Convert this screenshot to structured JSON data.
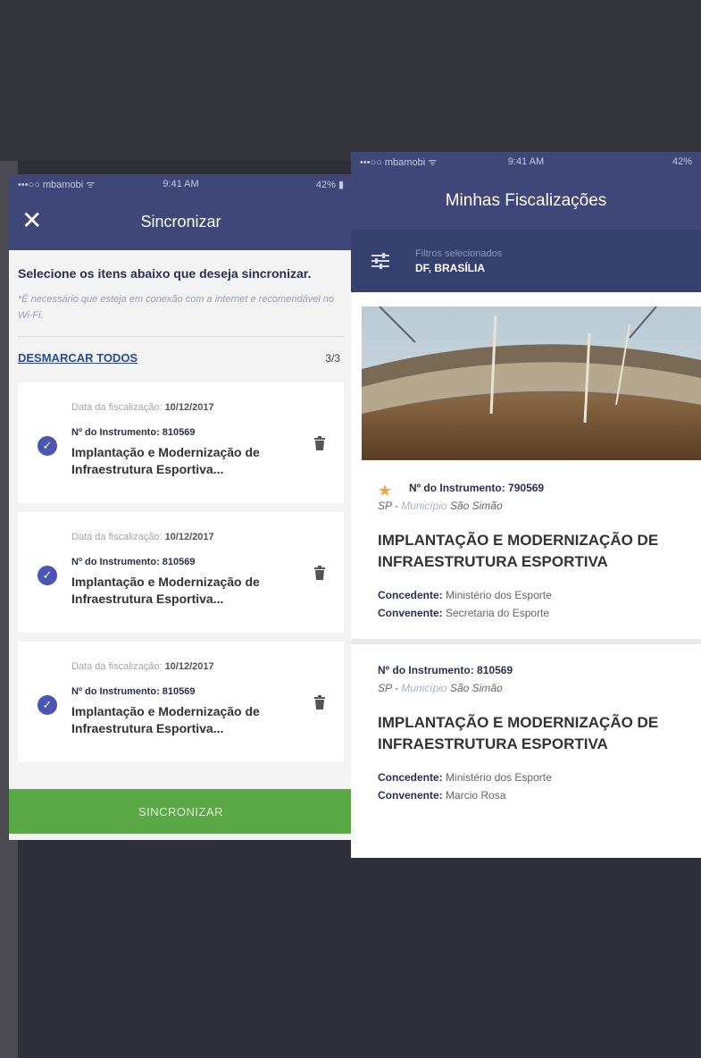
{
  "left_phone": {
    "status": {
      "carrier": "•••○○ mbamobi ᯤ",
      "time": "9:41 AM",
      "battery": "42% ▮"
    },
    "nav": {
      "close_glyph": "✕",
      "title": "Sincronizar"
    },
    "intro": {
      "headline": "Selecione os itens abaixo que deseja sincronizar.",
      "note": "*É necessário que esteja em conexão com a internet e recomendável no Wi-Fi."
    },
    "toolbar": {
      "toggle_label": "DESMARCAR TODOS",
      "count": "3/3"
    },
    "items": [
      {
        "date_label": "Data da fiscalização:",
        "date": "10/12/2017",
        "instrument": "Nº do Instrumento: 810569",
        "name": "Implantação e Modernização de Infraestrutura Esportiva...",
        "checked": "✓"
      },
      {
        "date_label": "Data da fiscalização:",
        "date": "10/12/2017",
        "instrument": "Nº do Instrumento: 810569",
        "name": "Implantação e Modernização de Infraestrutura Esportiva...",
        "checked": "✓"
      },
      {
        "date_label": "Data da fiscalização:",
        "date": "10/12/2017",
        "instrument": "Nº do Instrumento: 810569",
        "name": "Implantação e Modernização de Infraestrutura Esportiva...",
        "checked": "✓"
      }
    ],
    "sync_button": "SINCRONIZAR"
  },
  "right_phone": {
    "status": {
      "carrier": "•••○○ mbamobi ᯤ",
      "time": "9:41 AM",
      "battery": "42%"
    },
    "nav": {
      "title": "Minhas Fiscalizações"
    },
    "filters": {
      "label": "Filtros selecionados",
      "value": "DF, BRASÍLIA"
    },
    "cards": [
      {
        "instrument": "Nº do Instrumento: 790569",
        "loc_prefix": "SP - ",
        "loc_label": "Município",
        "loc_value": "São Simão",
        "title": "IMPLANTAÇÃO E MODERNIZAÇÃO DE INFRAESTRUTURA ESPORTIVA",
        "concedente_k": "Concedente:",
        "concedente_v": "Ministério dos Esporte",
        "convenente_k": "Convenente:",
        "convenente_v": "Secretaria do Esporte"
      },
      {
        "instrument": "Nº do Instrumento: 810569",
        "loc_prefix": "SP - ",
        "loc_label": "Município",
        "loc_value": "São Simão",
        "title": "IMPLANTAÇÃO E MODERNIZAÇÃO DE INFRAESTRUTURA ESPORTIVA",
        "concedente_k": "Concedente:",
        "concedente_v": "Ministério dos Esporte",
        "convenente_k": "Convenente:",
        "convenente_v": "Marcio Rosa"
      }
    ]
  },
  "colors": {
    "nav": "#3e4778",
    "accent_green": "#5aa946",
    "star": "#f0a43c",
    "check": "#4a55b4"
  },
  "icons": [
    "close-icon",
    "check-icon",
    "trash-icon",
    "filter-icon",
    "star-icon"
  ]
}
